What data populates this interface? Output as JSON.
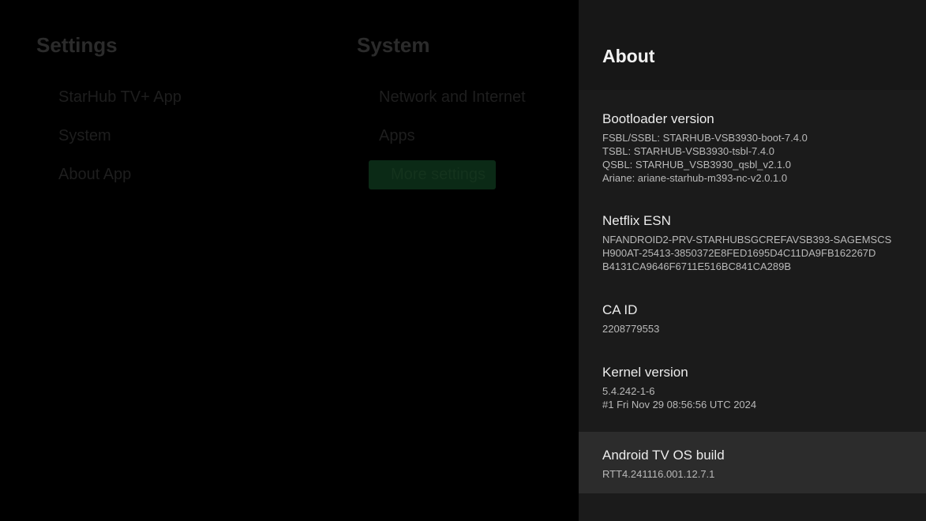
{
  "settings": {
    "title": "Settings",
    "items": [
      {
        "label": "StarHub TV+ App"
      },
      {
        "label": "System"
      },
      {
        "label": "About App"
      }
    ]
  },
  "system": {
    "title": "System",
    "items": [
      {
        "label": "Network and Internet"
      },
      {
        "label": "Apps"
      },
      {
        "label": "More settings"
      }
    ]
  },
  "about": {
    "title": "About",
    "bootloader": {
      "label": "Bootloader version",
      "lines": [
        "FSBL/SSBL: STARHUB-VSB3930-boot-7.4.0",
        "TSBL: STARHUB-VSB3930-tsbl-7.4.0",
        "QSBL: STARHUB_VSB3930_qsbl_v2.1.0",
        "Ariane: ariane-starhub-m393-nc-v2.0.1.0"
      ]
    },
    "netflix_esn": {
      "label": "Netflix ESN",
      "lines": [
        "NFANDROID2-PRV-STARHUBSGCREFAVSB393-SAGEMSCS",
        "H900AT-25413-3850372E8FED1695D4C11DA9FB162267D",
        "B4131CA9646F6711E516BC841CA289B"
      ]
    },
    "ca_id": {
      "label": "CA ID",
      "lines": [
        "2208779553"
      ]
    },
    "kernel": {
      "label": "Kernel version",
      "lines": [
        "5.4.242-1-6",
        "#1 Fri Nov 29 08:56:56 UTC 2024"
      ]
    },
    "android_build": {
      "label": "Android TV OS build",
      "lines": [
        "RTT4.241116.001.12.7.1"
      ]
    }
  }
}
